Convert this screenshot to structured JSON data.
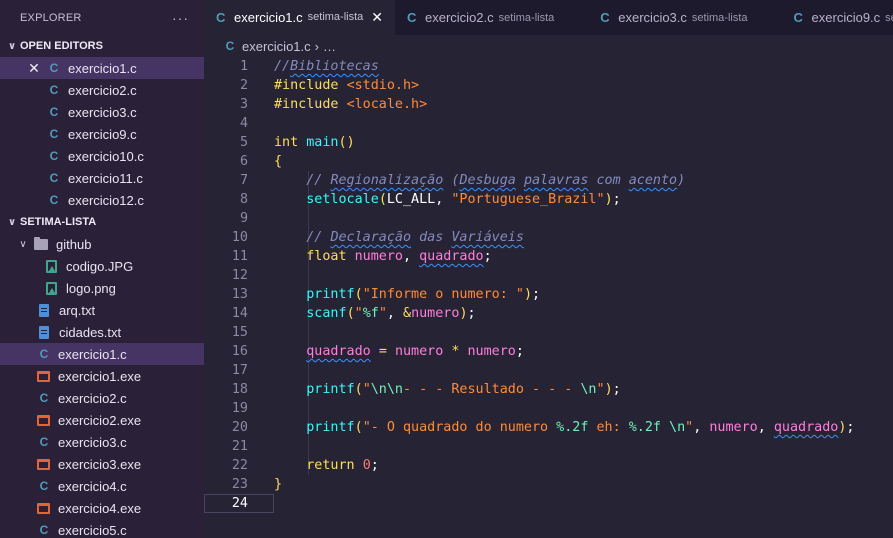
{
  "explorer": {
    "title": "EXPLORER",
    "more_label": "···",
    "open_editors": {
      "label": "OPEN EDITORS",
      "files": [
        "exercicio1.c",
        "exercicio2.c",
        "exercicio3.c",
        "exercicio9.c",
        "exercicio10.c",
        "exercicio11.c",
        "exercicio12.c"
      ]
    },
    "workspace": {
      "label": "SETIMA-LISTA",
      "folder": "github",
      "folder_files": [
        "codigo.JPG",
        "logo.png"
      ],
      "files": [
        "arq.txt",
        "cidades.txt",
        "exercicio1.c",
        "exercicio1.exe",
        "exercicio2.c",
        "exercicio2.exe",
        "exercicio3.c",
        "exercicio3.exe",
        "exercicio4.c",
        "exercicio4.exe",
        "exercicio5.c"
      ]
    }
  },
  "tabs": [
    {
      "name": "exercicio1.c",
      "desc": "setima-lista",
      "active": true
    },
    {
      "name": "exercicio2.c",
      "desc": "setima-lista"
    },
    {
      "name": "exercicio3.c",
      "desc": "setima-lista"
    },
    {
      "name": "exercicio9.c",
      "desc": "setima-lista"
    }
  ],
  "breadcrumb": {
    "file": "exercicio1.c",
    "more": "…"
  },
  "editor": {
    "current_line": 24,
    "lines": [
      "//Bibliotecas",
      "#include <stdio.h>",
      "#include <locale.h>",
      "",
      "int main()",
      "{",
      "    // Regionalização (Desbuga palavras com acento)",
      "    setlocale(LC_ALL, \"Portuguese_Brazil\");",
      "",
      "    // Declaração das Variáveis",
      "    float numero, quadrado;",
      "",
      "    printf(\"Informe o numero: \");",
      "    scanf(\"%f\", &numero);",
      "",
      "    quadrado = numero * numero;",
      "",
      "    printf(\"\\n\\n- - - Resultado - - - \\n\");",
      "",
      "    printf(\"- O quadrado do numero %.2f eh: %.2f \\n\", numero, quadrado);",
      "",
      "    return 0;",
      "}",
      ""
    ]
  },
  "colors": {
    "sidebar_bg": "#2a2139",
    "editor_bg": "#262335",
    "comment": "#848bbd",
    "keyword": "#fede5d",
    "string": "#ff8b39",
    "function": "#36f9f6",
    "variable": "#ff7edb",
    "escape": "#72f1b8",
    "number": "#f97e72",
    "c_icon": "#519aba"
  }
}
